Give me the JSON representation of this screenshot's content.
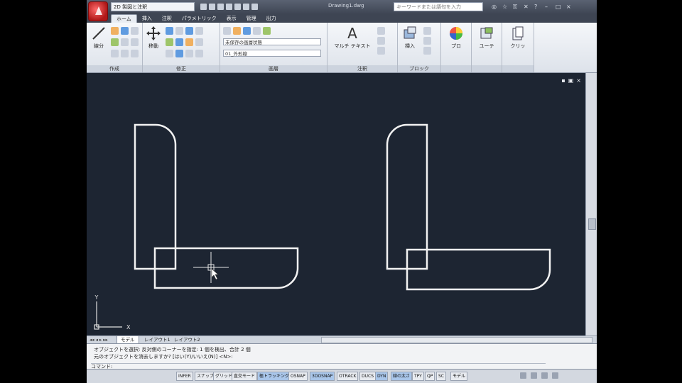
{
  "app": {
    "workspace": "2D 製図と注釈",
    "document_title": "Drawing1.dwg",
    "search_placeholder": "キーワードまたは語句を入力"
  },
  "tabs": [
    "ホーム",
    "挿入",
    "注釈",
    "パラメトリック",
    "表示",
    "管理",
    "出力"
  ],
  "ribbon": {
    "draw": {
      "label": "作成",
      "line": "線分"
    },
    "modify": {
      "label": "修正",
      "move": "移動"
    },
    "layers": {
      "label": "画層",
      "state": "未保存の画層状態",
      "current": "01_外形線"
    },
    "annotation": {
      "label": "注釈",
      "mtext": "マルチ テキスト"
    },
    "block": {
      "label": "ブロック",
      "insert": "挿入"
    },
    "properties": {
      "label": "プロ"
    },
    "utilities": {
      "label": "ユーテ"
    },
    "clipboard": {
      "label": "クリッ"
    }
  },
  "layout_tabs": [
    "モデル",
    "レイアウト1",
    "レイアウト2"
  ],
  "ucs": {
    "y": "Y",
    "x": "X"
  },
  "command": {
    "line1": "オブジェクトを選択: 反対側のコーナーを指定: 1 個を検出、合計 2 個",
    "line2": "元のオブジェクトを消去しますか? [はい(Y)/いいえ(N)] <N>:",
    "prompt": "コマンド:"
  },
  "status_buttons": [
    "INFER",
    "スナップ",
    "グリッド",
    "直交モード",
    "極トラッキング",
    "OSNAP",
    "3DOSNAP",
    "OTRACK",
    "DUCS",
    "DYN",
    "線の太さ",
    "TPY",
    "QP",
    "SC",
    "モデル"
  ],
  "colors": {
    "canvas": "#1d2532",
    "geometry": "#f2f2f2",
    "accent": "#c21f1f"
  }
}
